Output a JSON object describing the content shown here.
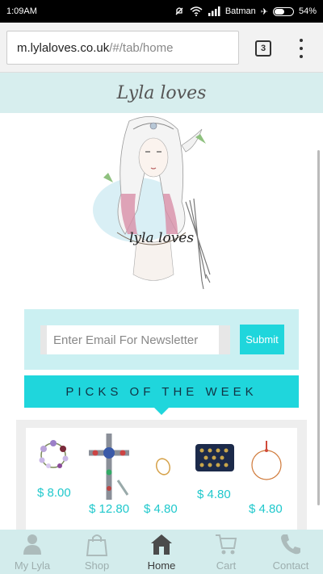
{
  "status_bar": {
    "time": "1:09AM",
    "carrier": "Batman",
    "battery": "54%"
  },
  "browser": {
    "url_host": "m.lylaloves.co.uk",
    "url_path": "/#/tab/home",
    "tab_count": "3"
  },
  "brand": {
    "title": "Lyla loves"
  },
  "newsletter": {
    "placeholder": "Enter Email For Newsletter",
    "submit_label": "Submit"
  },
  "picks": {
    "heading": "PICKS OF THE WEEK"
  },
  "products": [
    {
      "name": "flower-crown",
      "price": "$ 8.00"
    },
    {
      "name": "cross-necklace",
      "price": "$ 12.80"
    },
    {
      "name": "gold-ring",
      "price": "$ 4.80"
    },
    {
      "name": "patterned-purse",
      "price": "$ 4.80"
    },
    {
      "name": "bracelet",
      "price": "$ 4.80"
    }
  ],
  "bottom_nav": [
    {
      "label": "My Lyla",
      "icon": "person-icon",
      "active": false
    },
    {
      "label": "Shop",
      "icon": "shopping-bag-icon",
      "active": false
    },
    {
      "label": "Home",
      "icon": "home-icon",
      "active": true
    },
    {
      "label": "Cart",
      "icon": "cart-icon",
      "active": false
    },
    {
      "label": "Contact",
      "icon": "phone-icon",
      "active": false
    }
  ],
  "colors": {
    "accent": "#1fd6dc",
    "brand_bg": "#d7eeee",
    "newsletter_bg": "#cbf0f2",
    "price": "#1fc8cc"
  }
}
